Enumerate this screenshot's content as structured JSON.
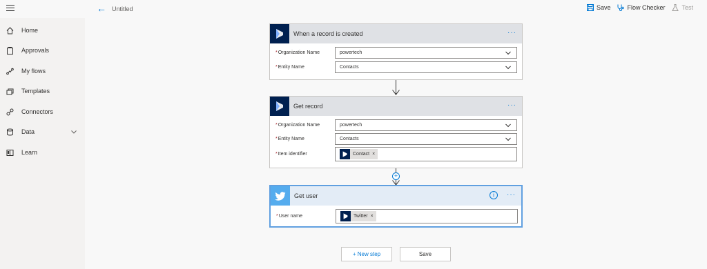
{
  "header": {
    "title": "Untitled",
    "actions": [
      {
        "label": "Save",
        "icon": "save-icon"
      },
      {
        "label": "Flow Checker",
        "icon": "stethoscope-icon"
      },
      {
        "label": "Test",
        "icon": "flask-icon"
      }
    ]
  },
  "sidebar": {
    "items": [
      {
        "label": "Home",
        "icon": "home-icon"
      },
      {
        "label": "Approvals",
        "icon": "approvals-icon"
      },
      {
        "label": "My flows",
        "icon": "flows-icon"
      },
      {
        "label": "Templates",
        "icon": "templates-icon"
      },
      {
        "label": "Connectors",
        "icon": "connectors-icon"
      },
      {
        "label": "Data",
        "icon": "data-icon"
      },
      {
        "label": "Learn",
        "icon": "learn-icon"
      }
    ]
  },
  "cards": [
    {
      "title": "When a record is created",
      "fields": [
        {
          "label": "Organization Name",
          "value": "powertech"
        },
        {
          "label": "Entity Name",
          "value": "Contacts"
        }
      ]
    },
    {
      "title": "Get record",
      "fields": [
        {
          "label": "Organization Name",
          "value": "powertech"
        },
        {
          "label": "Entity Name",
          "value": "Contacts"
        },
        {
          "label": "Item identifier",
          "token": "Contact"
        }
      ]
    },
    {
      "title": "Get user",
      "fields": [
        {
          "label": "User name",
          "token": "Twitter"
        }
      ]
    }
  ],
  "required_mark": "*",
  "token_remove": "×",
  "more_glyph": "···",
  "info_glyph": "i",
  "buttons": {
    "new_step": "+ New step",
    "save": "Save"
  },
  "colors": {
    "accent": "#0078d4",
    "dynamics": "#002050",
    "twitter": "#55acee"
  }
}
